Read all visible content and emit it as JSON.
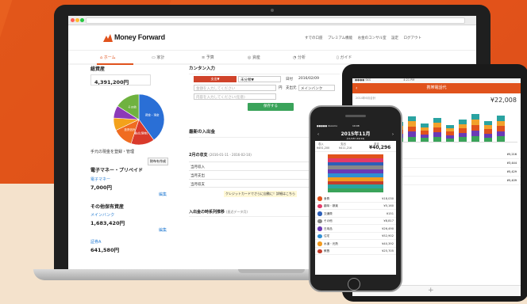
{
  "browser": {
    "url_text": ""
  },
  "header": {
    "logo": "Money Forward",
    "links": [
      "すでの口座",
      "プレミアム機能",
      "お金のコンサル室",
      "設定",
      "ログアウト"
    ]
  },
  "nav": {
    "items": [
      {
        "icon": "home-icon",
        "label": "ホーム",
        "active": true
      },
      {
        "icon": "wallet-icon",
        "label": "家計"
      },
      {
        "icon": "list-icon",
        "label": "予算"
      },
      {
        "icon": "coin-icon",
        "label": "資産"
      },
      {
        "icon": "chart-icon",
        "label": "分析"
      },
      {
        "icon": "book-icon",
        "label": "ガイド"
      }
    ]
  },
  "assets": {
    "title": "総資産",
    "total": "4,391,200円",
    "pie": [
      {
        "label": "預金・現金",
        "value": 40,
        "color": "#2a6fd6"
      },
      {
        "label": "株式(現物)",
        "value": 15,
        "color": "#d93a2b"
      },
      {
        "label": "投資信託",
        "value": 13,
        "color": "#f06c20"
      },
      {
        "label": "年金",
        "value": 8,
        "color": "#f3a21b"
      },
      {
        "label": "ポイント",
        "value": 8,
        "color": "#8c3ab8"
      },
      {
        "label": "その他",
        "value": 16,
        "color": "#6fb23f"
      }
    ],
    "cash_label": "手元の現金を登録・管理",
    "cash_button": "財布を作成"
  },
  "emoney": {
    "title": "電子マネー・プリペイド",
    "item": "電子マネー",
    "amount": "7,000円",
    "edit": "編集"
  },
  "other": {
    "title": "その他保有資産",
    "item": "メインバンク",
    "amount": "1,683,420円",
    "edit": "編集",
    "item2": "証券A",
    "amount2": "641,580円"
  },
  "quick": {
    "title": "カンタン入力",
    "tab_expense": "支出▼",
    "tab_income": "未分類▼",
    "date_label": "日付",
    "date_value": "2016/02/09",
    "amount_placeholder": "金額を入力してください",
    "yen": "円",
    "source_label": "支出元",
    "source_value": "メインバンク",
    "memo_placeholder": "内容を入力してください(任意)",
    "save": "保存する"
  },
  "recent": {
    "title": "最新の入出金"
  },
  "monthly": {
    "title": "2月の収支",
    "range": "(2016-01-11 - 2016-02-10)",
    "rows": [
      "当月収入",
      "当月支出",
      "当月収支"
    ],
    "card_note": "クレジットカードでさらに自動に！詳細はこちら"
  },
  "trend": {
    "title": "入出金の時系列推移",
    "sub": "(直近データ月)"
  },
  "tablet": {
    "status": "●●●● SKS",
    "time": "4:21 PM",
    "title": "携帯電話代",
    "sub": "2014年6月合計",
    "amount": "¥22,008",
    "rows": [
      "¥5,216",
      "¥3,444",
      "¥5,429",
      "¥5,409"
    ]
  },
  "phone": {
    "status": "●●●●● docomo",
    "time": "10:08",
    "month": "2015年11月",
    "range": "(11/18〜12/14)",
    "income_label": "収入",
    "income": "¥451,200",
    "expense_label": "支出",
    "expense": "¥411,216",
    "balance_label": "収支",
    "balance": "¥40,296",
    "items": [
      {
        "label": "食費",
        "value": "¥18,030",
        "color": "#e0521c"
      },
      {
        "label": "趣味・娯楽",
        "value": "¥5,160",
        "color": "#e23b6a"
      },
      {
        "label": "交通費",
        "value": "¥151",
        "color": "#2d5fb8"
      },
      {
        "label": "その他",
        "value": "¥8,817",
        "color": "#888888"
      },
      {
        "label": "日用品",
        "value": "¥26,490",
        "color": "#6a3ab5"
      },
      {
        "label": "住宅",
        "value": "¥52,902",
        "color": "#2f8fd2"
      },
      {
        "label": "水道・光熱",
        "value": "¥40,392",
        "color": "#f29a1e"
      },
      {
        "label": "教養",
        "value": "¥25,705",
        "color": "#c43d2c"
      }
    ]
  }
}
